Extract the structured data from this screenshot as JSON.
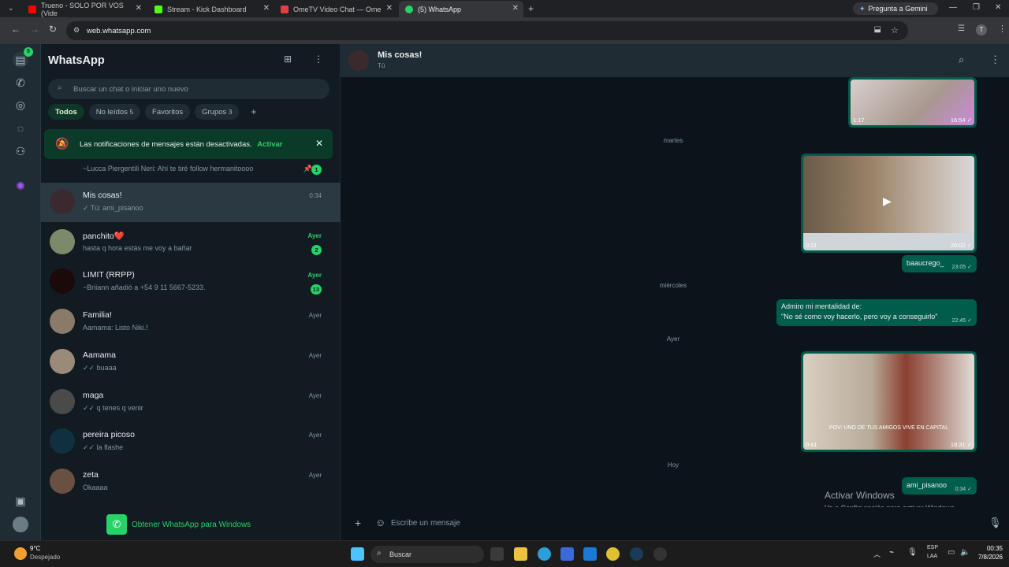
{
  "browser": {
    "tabs": [
      {
        "title": "Trueno - SOLO POR VOS (Vide",
        "color": "#ff0000"
      },
      {
        "title": "Stream - Kick Dashboard",
        "color": "#53fc18"
      },
      {
        "title": "OmeTV Video Chat — Ome",
        "color": "#e04040"
      },
      {
        "title": "(5) WhatsApp",
        "color": "#25d366"
      }
    ],
    "gemini_label": "Pregunta a Gemini",
    "url": "web.whatsapp.com",
    "avatar_letter": "T"
  },
  "sidebar": {
    "title": "WhatsApp",
    "rail_badge": "5",
    "search_placeholder": "Buscar un chat o iniciar uno nuevo",
    "filters": [
      {
        "label": "Todos",
        "count": ""
      },
      {
        "label": "No leídos",
        "count": "5"
      },
      {
        "label": "Favoritos",
        "count": ""
      },
      {
        "label": "Grupos",
        "count": "3"
      }
    ],
    "filter_add": "+",
    "notification": {
      "text": "Las notificaciones de mensajes están desactivadas.",
      "action": "Activar"
    },
    "partial_chat": {
      "msg": "~Lucca Piergentili Neri: Ahí te tiré follow hermanitoooo",
      "badge": "1"
    },
    "chats": [
      {
        "name": "Mis cosas!",
        "msg": "✓ Tú: ami_pisanoo",
        "time": "0:34",
        "unread": "",
        "color": "#3b2a2d"
      },
      {
        "name": "panchito❤️",
        "msg": "hasta q hora estás me voy a bañar",
        "time": "Ayer",
        "unread": "2",
        "color": "#7d8a6a"
      },
      {
        "name": "LIMIT (RRPP)",
        "msg": "~Briiann añadió a +54 9 11 5667-5233.",
        "time": "Ayer",
        "unread": "13",
        "color": "#1a0a0a"
      },
      {
        "name": "Familia!",
        "msg": "Aamama: Listo Niki.!",
        "time": "Ayer",
        "unread": "",
        "color": "#8a7a6a"
      },
      {
        "name": "Aamama",
        "msg": "✓✓ buaaa",
        "time": "Ayer",
        "unread": "",
        "color": "#9a8a7a"
      },
      {
        "name": "maga",
        "msg": "✓✓ q tenes q venir",
        "time": "Ayer",
        "unread": "",
        "color": "#4a4a4a"
      },
      {
        "name": "pereira picoso",
        "msg": "✓✓ la flashe",
        "time": "Ayer",
        "unread": "",
        "color": "#103040"
      },
      {
        "name": "zeta",
        "msg": "Okaaaa",
        "time": "Ayer",
        "unread": "",
        "color": "#6a5040"
      }
    ],
    "get_app": "Obtener WhatsApp para Windows"
  },
  "chat": {
    "name": "Mis cosas!",
    "subtitle": "Tú",
    "dividers": [
      "martes",
      "miércoles",
      "Ayer",
      "Hoy"
    ],
    "video1": {
      "duration": "1:17",
      "time": "16:54 ✓"
    },
    "video2": {
      "duration": "0:21",
      "time": "20:02 ✓"
    },
    "text1": {
      "text": "baaucrego_",
      "time": "23:05 ✓"
    },
    "text2": {
      "line1": "Admiro mi mentalidad de:",
      "line2": "\"No sé como voy hacerlo, pero voy a conseguirlo\"",
      "time": "22:45 ✓"
    },
    "video3": {
      "duration": "0:41",
      "time": "18:31 ✓",
      "caption": "POV: UNO DE TUS AMIGOS VIVE EN CAPITAL"
    },
    "text3": {
      "text": "ami_pisanoo",
      "time": "0:34 ✓"
    },
    "composer_placeholder": "Escribe un mensaje",
    "watermark_title": "Activar Windows",
    "watermark_sub": "Ve a Configuración para activar Windows."
  },
  "taskbar": {
    "weather_temp": "9°C",
    "weather_desc": "Despejado",
    "search": "Buscar",
    "lang1": "ESP",
    "lang2": "LAA",
    "clock_time": "00:35",
    "clock_date": "7/8/2026"
  }
}
